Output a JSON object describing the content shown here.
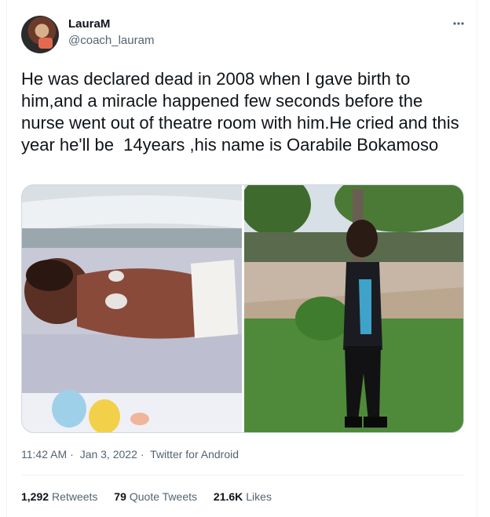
{
  "tweet": {
    "display_name": "LauraM",
    "handle": "@coach_lauram",
    "more_icon": "more-horizontal-icon",
    "text": "He was declared dead in 2008 when I gave birth to him,and a miracle happened few seconds before the nurse went out of theatre room with him.He cried and this year he'll be  14years ,his name is Oarabile Bokamoso",
    "time": "11:42 AM",
    "separator": "·",
    "date": "Jan 3, 2022",
    "source": "Twitter for Android",
    "stats": [
      {
        "count": "1,292",
        "label": "Retweets"
      },
      {
        "count": "79",
        "label": "Quote Tweets"
      },
      {
        "count": "21.6K",
        "label": "Likes"
      }
    ]
  },
  "colors": {
    "text_primary": "#0f1419",
    "text_secondary": "#536471",
    "border": "#cfd9de"
  }
}
